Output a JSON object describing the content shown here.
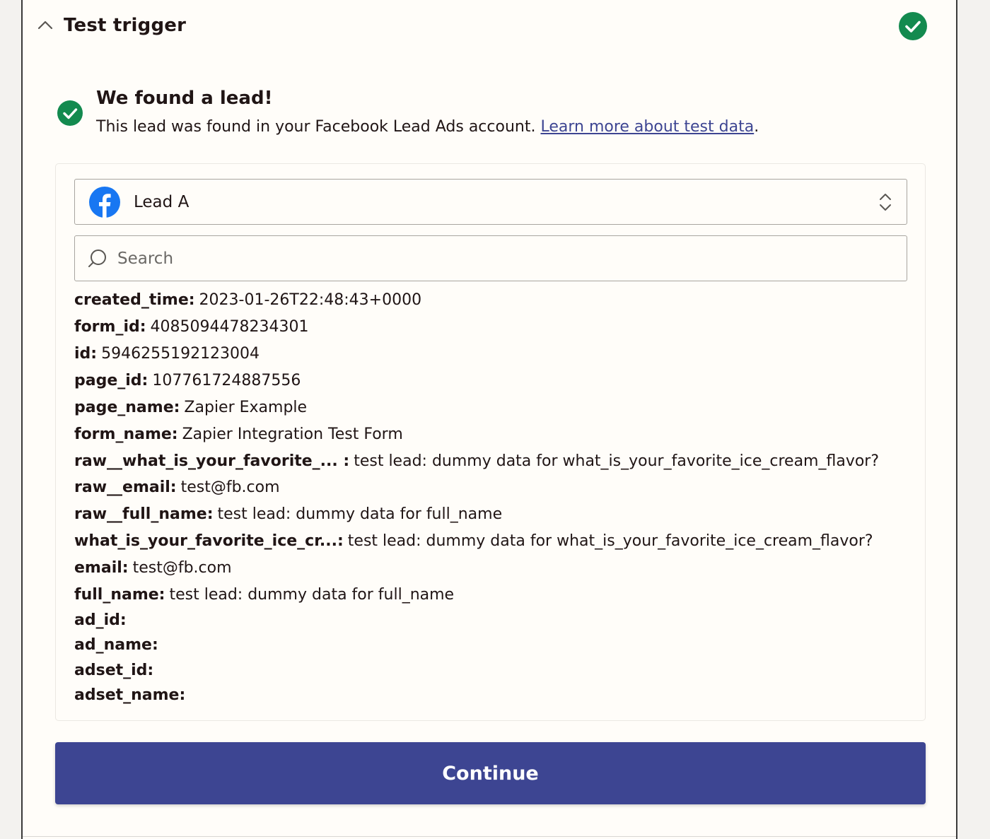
{
  "header": {
    "title": "Test trigger",
    "status_icon": "check-circle-icon",
    "status_color": "#138a4f"
  },
  "result": {
    "title": "We found a lead!",
    "description": "This lead was found in your Facebook Lead Ads account.",
    "link_label": "Learn more about test data",
    "trailing": "."
  },
  "lead_select": {
    "icon": "facebook-icon",
    "selected": "Lead A"
  },
  "search": {
    "placeholder": "Search",
    "value": ""
  },
  "fields": [
    {
      "key": "created_time:",
      "value": "2023-01-26T22:48:43+0000"
    },
    {
      "key": "form_id:",
      "value": "4085094478234301"
    },
    {
      "key": "id:",
      "value": "5946255192123004"
    },
    {
      "key": "page_id:",
      "value": "107761724887556"
    },
    {
      "key": "page_name:",
      "value": "Zapier Example"
    },
    {
      "key": "form_name:",
      "value": "Zapier Integration Test Form"
    },
    {
      "key": "raw__what_is_your_favorite_... :",
      "value": "test lead: dummy data for what_is_your_favorite_ice_cream_flavor?"
    },
    {
      "key": "raw__email:",
      "value": "test@fb.com"
    },
    {
      "key": "raw__full_name:",
      "value": "test lead: dummy data for full_name"
    },
    {
      "key": "what_is_your_favorite_ice_cr...:",
      "value": "test lead: dummy data for what_is_your_favorite_ice_cream_flavor?"
    },
    {
      "key": "email:",
      "value": "test@fb.com"
    },
    {
      "key": "full_name:",
      "value": "test lead: dummy data for full_name"
    },
    {
      "key": "ad_id:",
      "value": ""
    },
    {
      "key": "ad_name:",
      "value": ""
    },
    {
      "key": "adset_id:",
      "value": ""
    },
    {
      "key": "adset_name:",
      "value": ""
    }
  ],
  "actions": {
    "continue_label": "Continue"
  },
  "colors": {
    "accent": "#3d4592",
    "success": "#138a4f",
    "facebook": "#1877f2"
  }
}
